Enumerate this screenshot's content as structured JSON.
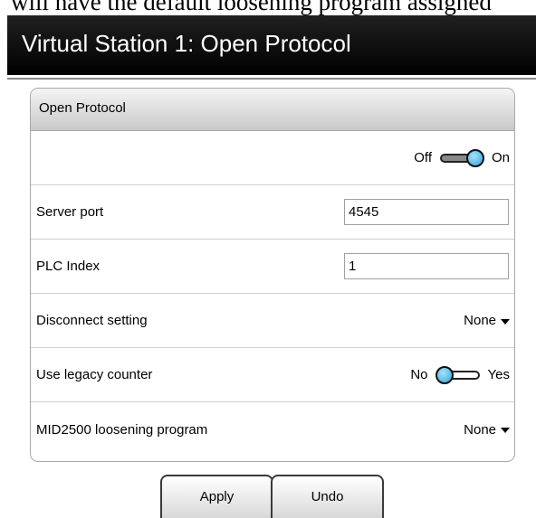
{
  "snippet": {
    "text": "will have the default loosening program assigned"
  },
  "header": {
    "title": "Virtual Station 1: Open Protocol"
  },
  "panel": {
    "title": "Open Protocol",
    "enable_toggle": {
      "off_label": "Off",
      "on_label": "On",
      "state": "on"
    },
    "server_port": {
      "label": "Server port",
      "value": "4545"
    },
    "plc_index": {
      "label": "PLC Index",
      "value": "1"
    },
    "disconnect_setting": {
      "label": "Disconnect setting",
      "value": "None"
    },
    "legacy_counter": {
      "label": "Use legacy counter",
      "off_label": "No",
      "on_label": "Yes",
      "state": "no"
    },
    "mid2500": {
      "label": "MID2500 loosening program",
      "value": "None"
    }
  },
  "buttons": {
    "apply": "Apply",
    "undo": "Undo"
  },
  "colors": {
    "accent": "#2aa7dd",
    "titlebar": "#000000"
  }
}
